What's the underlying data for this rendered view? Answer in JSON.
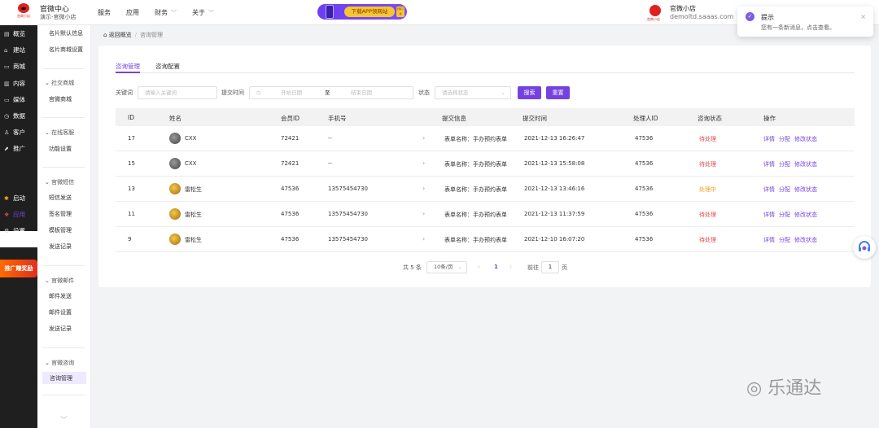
{
  "header": {
    "logo_text": "宫商小店",
    "store_name": "官微中心",
    "store_sub": "演示-官微小店",
    "nav": [
      {
        "label": "服务"
      },
      {
        "label": "应用"
      },
      {
        "label": "财务"
      },
      {
        "label": "关于"
      }
    ],
    "banner_label": "下载APP领网站",
    "banner_qr": "扫码下载",
    "shop_logo_text": "宫商小店",
    "shop_name": "官微小店",
    "shop_domain": "demoltd.saaas.com"
  },
  "notification": {
    "title": "提示",
    "message": "您有一条新消息，点击查看。",
    "close": "×"
  },
  "sidebar": {
    "items": [
      {
        "icon": "overview-icon",
        "glyph": "▤",
        "label": "概览"
      },
      {
        "icon": "site-icon",
        "glyph": "⌂",
        "label": "建站"
      },
      {
        "icon": "mall-icon",
        "glyph": "▭",
        "label": "商城"
      },
      {
        "icon": "content-icon",
        "glyph": "▥",
        "label": "内容"
      },
      {
        "icon": "media-icon",
        "glyph": "▭",
        "label": "媒体"
      },
      {
        "icon": "data-icon",
        "glyph": "◷",
        "label": "数据"
      },
      {
        "icon": "customer-icon",
        "glyph": "♙",
        "label": "客户"
      },
      {
        "icon": "promote-icon",
        "glyph": "⬈",
        "label": "推广"
      },
      {
        "icon": "launch-icon",
        "glyph": "✱",
        "label": "启动"
      },
      {
        "icon": "apps-icon",
        "glyph": "❖",
        "label": "应用"
      },
      {
        "icon": "settings-icon",
        "glyph": "⚙",
        "label": "设置"
      }
    ],
    "promo": "推广赚奖励"
  },
  "subsidebar": {
    "top_items": [
      "名片默认信息",
      "名片商城设置"
    ],
    "groups": [
      {
        "title": "社交商城",
        "items": [
          "官微商城"
        ]
      },
      {
        "title": "在线客服",
        "items": [
          "功能设置"
        ]
      },
      {
        "title": "官微短信",
        "items": [
          "短信发送",
          "签名管理",
          "模板管理",
          "发送记录"
        ]
      },
      {
        "title": "官微邮件",
        "items": [
          "邮件发送",
          "邮件设置",
          "发送记录"
        ]
      },
      {
        "title": "官微咨询",
        "items": [
          "咨询管理"
        ]
      }
    ]
  },
  "breadcrumb": {
    "back": "返回概览",
    "separator": "/",
    "current": "咨询管理"
  },
  "tabs": [
    "咨询管理",
    "咨询配置"
  ],
  "filters": {
    "keyword_label": "关键词",
    "keyword_placeholder": "请输入关键词",
    "time_label": "提交时间",
    "start_placeholder": "开始日期",
    "to": "至",
    "end_placeholder": "结束日期",
    "status_label": "状态",
    "status_placeholder": "请选择状态",
    "search_button": "搜索",
    "reset_button": "重置"
  },
  "table": {
    "columns": [
      "ID",
      "姓名",
      "会员ID",
      "手机号",
      "提交信息",
      "提交时间",
      "处理人ID",
      "咨询状态",
      "操作"
    ],
    "rows": [
      {
        "id": "17",
        "name": "CXX",
        "member_id": "72421",
        "phone": "--",
        "info": "表单名称：手办预约表单",
        "time": "2021-12-13 16:26:47",
        "handler": "47536",
        "status": "待处理",
        "status_color": "#e5484d"
      },
      {
        "id": "15",
        "name": "CXX",
        "member_id": "72421",
        "phone": "--",
        "info": "表单名称：手办预约表单",
        "time": "2021-12-13 15:58:08",
        "handler": "47536",
        "status": "待处理",
        "status_color": "#e5484d"
      },
      {
        "id": "13",
        "name": "雷松生",
        "member_id": "47536",
        "phone": "13575454730",
        "info": "表单名称：手办预约表单",
        "time": "2021-12-13 13:46:16",
        "handler": "47536",
        "status": "处理中",
        "status_color": "#f0a020"
      },
      {
        "id": "11",
        "name": "雷松生",
        "member_id": "47536",
        "phone": "13575454730",
        "info": "表单名称：手办预约表单",
        "time": "2021-12-13 11:37:59",
        "handler": "47536",
        "status": "待处理",
        "status_color": "#e5484d"
      },
      {
        "id": "9",
        "name": "雷松生",
        "member_id": "47536",
        "phone": "13575454730",
        "info": "表单名称：手办预约表单",
        "time": "2021-12-10 16:07:20",
        "handler": "47536",
        "status": "待处理",
        "status_color": "#e5484d"
      }
    ],
    "actions": [
      "详情",
      "分配",
      "修改状态"
    ]
  },
  "pagination": {
    "total": "共 5 条",
    "page_size": "10条/页",
    "prev": "‹",
    "current": "1",
    "next": "›",
    "goto_label": "前往",
    "goto_value": "1",
    "page_unit": "页"
  },
  "watermark": "乐通达",
  "colors": {
    "accent": "#7442e0",
    "pending": "#e5484d",
    "processing": "#f0a020"
  }
}
